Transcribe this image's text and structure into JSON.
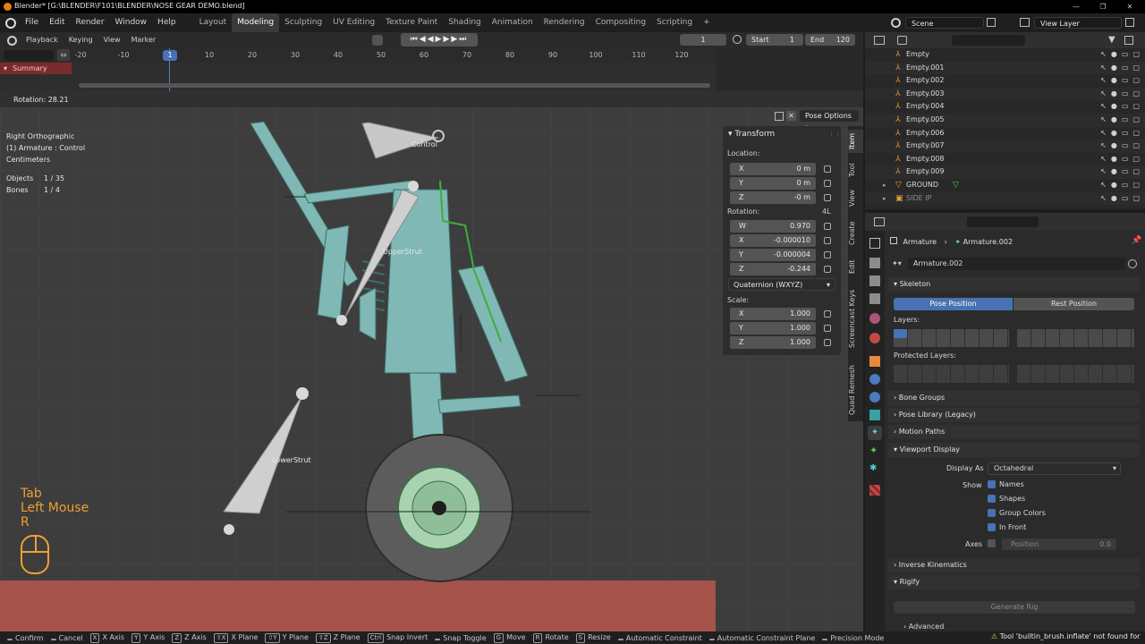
{
  "window": {
    "title": "Blender* [G:\\BLENDER\\F101\\BLENDER\\NOSE GEAR DEMO.blend]",
    "controls": [
      "—",
      "❐",
      "✕"
    ]
  },
  "menu": [
    "File",
    "Edit",
    "Render",
    "Window",
    "Help"
  ],
  "workspaces": [
    {
      "label": "Layout",
      "active": false
    },
    {
      "label": "Modeling",
      "active": true
    },
    {
      "label": "Sculpting",
      "active": false
    },
    {
      "label": "UV Editing",
      "active": false
    },
    {
      "label": "Texture Paint",
      "active": false
    },
    {
      "label": "Shading",
      "active": false
    },
    {
      "label": "Animation",
      "active": false
    },
    {
      "label": "Rendering",
      "active": false
    },
    {
      "label": "Compositing",
      "active": false
    },
    {
      "label": "Scripting",
      "active": false
    }
  ],
  "scene": {
    "name": "Scene",
    "view_layer": "View Layer"
  },
  "timeline": {
    "menus": [
      "Playback",
      "Keying",
      "View",
      "Marker"
    ],
    "current_frame": "1",
    "start_label": "Start",
    "start": "1",
    "end_label": "End",
    "end": "120",
    "ticks": [
      "-20",
      "-10",
      "1",
      "10",
      "20",
      "30",
      "40",
      "50",
      "60",
      "70",
      "80",
      "90",
      "100",
      "110",
      "120"
    ],
    "summary": "Summary"
  },
  "viewport": {
    "header_text": "Rotation: 28.21",
    "overlay": [
      "Right Orthographic",
      "(1) Armature : Control",
      "Centimeters"
    ],
    "stats": [
      {
        "label": "Objects",
        "value": "1 / 35"
      },
      {
        "label": "Bones",
        "value": "1 / 4"
      }
    ],
    "bone_labels": {
      "control": "Control",
      "upper": "UpperStrut",
      "lower": "LowerStrut"
    },
    "pose_options": "Pose Options",
    "screencast": [
      "Tab",
      "Left Mouse",
      "R"
    ]
  },
  "npanel": {
    "header": "Transform",
    "location_label": "Location:",
    "location": [
      {
        "axis": "X",
        "value": "0 m"
      },
      {
        "axis": "Y",
        "value": "0 m"
      },
      {
        "axis": "Z",
        "value": "-0 m"
      }
    ],
    "rotation_label": "Rotation:",
    "rotation_mode_short": "4L",
    "rotation": [
      {
        "axis": "W",
        "value": "0.970"
      },
      {
        "axis": "X",
        "value": "-0.000010"
      },
      {
        "axis": "Y",
        "value": "-0.000004"
      },
      {
        "axis": "Z",
        "value": "-0.244"
      }
    ],
    "rotation_mode": "Quaternion (WXYZ)",
    "scale_label": "Scale:",
    "scale": [
      {
        "axis": "X",
        "value": "1.000"
      },
      {
        "axis": "Y",
        "value": "1.000"
      },
      {
        "axis": "Z",
        "value": "1.000"
      }
    ],
    "tabs": [
      "Item",
      "Tool",
      "View",
      "Create",
      "Edit",
      "Screencast Keys",
      "Quad Remesh"
    ]
  },
  "outliner": {
    "items": [
      "Empty",
      "Empty.001",
      "Empty.002",
      "Empty.003",
      "Empty.004",
      "Empty.005",
      "Empty.006",
      "Empty.007",
      "Empty.008",
      "Empty.009",
      "GROUND",
      "SIDE IP"
    ]
  },
  "properties": {
    "breadcrumb": [
      "Armature",
      "Armature.002"
    ],
    "data_name": "Armature.002",
    "skeleton": "Skeleton",
    "pose_position": "Pose Position",
    "rest_position": "Rest Position",
    "layers": "Layers:",
    "protected_layers": "Protected Layers:",
    "sections": [
      "Bone Groups",
      "Pose Library (Legacy)",
      "Motion Paths",
      "Viewport Display"
    ],
    "display_as_label": "Display As",
    "display_as": "Octahedral",
    "show_label": "Show",
    "show": [
      {
        "label": "Names",
        "on": true
      },
      {
        "label": "Shapes",
        "on": true
      },
      {
        "label": "Group Colors",
        "on": true
      },
      {
        "label": "In Front",
        "on": true
      }
    ],
    "axes_label": "Axes",
    "position_label": "Position",
    "position_value": "0.0",
    "ik": "Inverse Kinematics",
    "rigify": "Rigify",
    "generate_rig": "Generate Rig",
    "advanced": "Advanced"
  },
  "statusbar": [
    {
      "key": "",
      "label": "Confirm"
    },
    {
      "key": "",
      "label": "Cancel"
    },
    {
      "key": "X",
      "label": "X Axis"
    },
    {
      "key": "Y",
      "label": "Y Axis"
    },
    {
      "key": "Z",
      "label": "Z Axis"
    },
    {
      "key": "⇧X",
      "label": "X Plane"
    },
    {
      "key": "⇧Y",
      "label": "Y Plane"
    },
    {
      "key": "⇧Z",
      "label": "Z Plane"
    },
    {
      "key": "Ctrl",
      "label": "Snap Invert"
    },
    {
      "key": "",
      "label": "Snap Toggle"
    },
    {
      "key": "G",
      "label": "Move"
    },
    {
      "key": "R",
      "label": "Rotate"
    },
    {
      "key": "S",
      "label": "Resize"
    },
    {
      "key": "",
      "label": "Automatic Constraint"
    },
    {
      "key": "",
      "label": "Automatic Constraint Plane"
    },
    {
      "key": "",
      "label": "Precision Mode"
    }
  ],
  "status_warning": "Tool 'builtin_brush.inflate' not found for",
  "colors": {
    "accent": "#4772b3",
    "gear": "#7fb8b4",
    "ground": "#a5534b",
    "tire": "#5c5c5c",
    "hub": "#a9d3b0",
    "bone": "#c8c8c8"
  }
}
